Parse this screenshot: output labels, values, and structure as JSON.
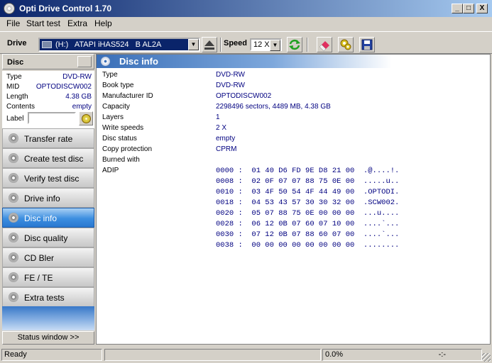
{
  "window": {
    "title": "Opti Drive Control 1.70",
    "controls": {
      "minimize": "_",
      "maximize": "□",
      "close": "X"
    }
  },
  "menu": [
    "File",
    "Start test",
    "Extra",
    "Help"
  ],
  "toolbar": {
    "drive_label": "Drive",
    "drive_value": "(H:)   ATAPI iHAS524   B AL2A",
    "speed_label": "Speed",
    "speed_value": "12 X",
    "icons": [
      "eject-icon",
      "refresh-icon",
      "erase-icon",
      "settings-icon",
      "save-icon"
    ]
  },
  "disc_panel": {
    "title": "Disc",
    "props": [
      {
        "key": "Type",
        "value": "DVD-RW"
      },
      {
        "key": "MID",
        "value": "OPTODISCW002"
      },
      {
        "key": "Length",
        "value": "4.38 GB"
      },
      {
        "key": "Contents",
        "value": "empty"
      }
    ],
    "label_caption": "Label",
    "label_value": ""
  },
  "nav": [
    {
      "label": "Transfer rate",
      "active": false
    },
    {
      "label": "Create test disc",
      "active": false
    },
    {
      "label": "Verify test disc",
      "active": false
    },
    {
      "label": "Drive info",
      "active": false
    },
    {
      "label": "Disc info",
      "active": true
    },
    {
      "label": "Disc quality",
      "active": false
    },
    {
      "label": "CD Bler",
      "active": false
    },
    {
      "label": "FE / TE",
      "active": false
    },
    {
      "label": "Extra tests",
      "active": false
    }
  ],
  "status_window_label": "Status window >>",
  "main": {
    "title": "Disc info",
    "rows": [
      {
        "key": "Type",
        "value": "DVD-RW"
      },
      {
        "key": "Book type",
        "value": "DVD-RW"
      },
      {
        "key": "Manufacturer ID",
        "value": "OPTODISCW002"
      },
      {
        "key": "Capacity",
        "value": "2298496 sectors, 4489 MB, 4.38 GB"
      },
      {
        "key": "Layers",
        "value": "1"
      },
      {
        "key": "Write speeds",
        "value": "2 X"
      },
      {
        "key": "Disc status",
        "value": "empty"
      },
      {
        "key": "Copy protection",
        "value": "CPRM"
      },
      {
        "key": "Burned with",
        "value": ""
      },
      {
        "key": "ADIP",
        "value": ""
      }
    ],
    "adip": [
      "0000 :  01 40 D6 FD 9E D8 21 00  .@....!.",
      "0008 :  02 0F 07 07 88 75 0E 00  .....u..",
      "0010 :  03 4F 50 54 4F 44 49 00  .OPTODI.",
      "0018 :  04 53 43 57 30 30 32 00  .SCW002.",
      "0020 :  05 07 88 75 0E 00 00 00  ...u....",
      "0028 :  06 12 0B 07 60 07 10 00  ....`...",
      "0030 :  07 12 0B 07 88 60 07 00  ....`...",
      "0038 :  00 00 00 00 00 00 00 00  ........"
    ]
  },
  "statusbar": {
    "status": "Ready",
    "progress_text": "0.0%",
    "progress": 0,
    "time": "-:-"
  }
}
